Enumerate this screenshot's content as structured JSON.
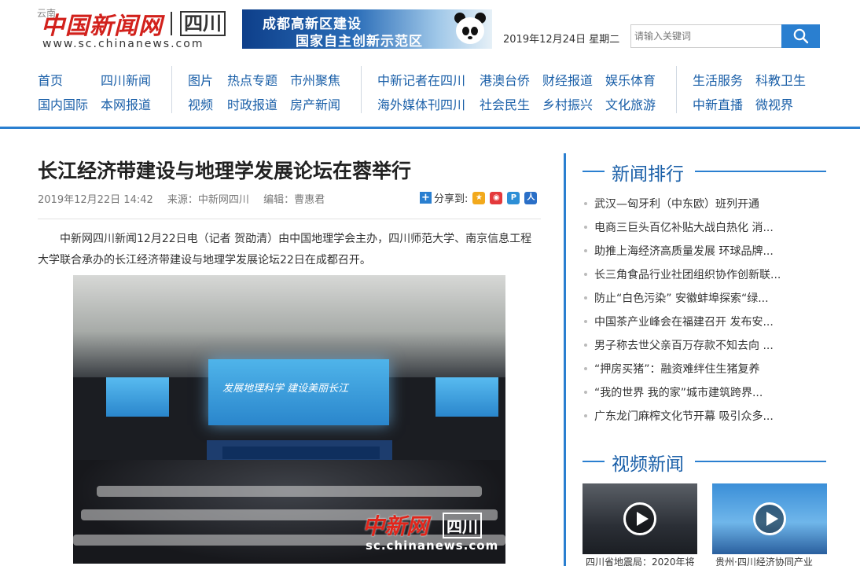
{
  "header": {
    "corner_text": "云南",
    "logo_cn": "中国新闻网",
    "logo_region": "四川",
    "logo_url": "www.sc.chinanews.com",
    "banner_line1": "成都高新区建设",
    "banner_line2": "国家自主创新示范区",
    "date": "2019年12月24日  星期二",
    "search_placeholder": "请输入关键词"
  },
  "nav": {
    "groups": [
      [
        [
          "首页",
          "四川新闻"
        ],
        [
          "国内国际",
          "本网报道"
        ]
      ],
      [
        [
          "图片",
          "热点专题",
          "市州聚焦"
        ],
        [
          "视频",
          "时政报道",
          "房产新闻"
        ]
      ],
      [
        [
          "中新记者在四川",
          "港澳台侨",
          "财经报道",
          "娱乐体育"
        ],
        [
          "海外媒体刊四川",
          "社会民生",
          "乡村振兴",
          "文化旅游"
        ]
      ],
      [
        [
          "生活服务",
          "科教卫生"
        ],
        [
          "中新直播",
          "微视界"
        ]
      ]
    ]
  },
  "article": {
    "title": "长江经济带建设与地理学发展论坛在蓉举行",
    "date": "2019年12月22日  14:42",
    "source": "来源：中新网四川",
    "editor": "编辑：曹惠君",
    "share_label": "分享到:",
    "body": "中新网四川新闻12月22日电（记者 贺劭清）由中国地理学会主办，四川师范大学、南京信息工程大学联合承办的长江经济带建设与地理学发展论坛22日在成都召开。",
    "photo_screen_text": "发展地理科学  建设美丽长江",
    "photo_watermark_cn": "中新网",
    "photo_watermark_region": "四川",
    "photo_watermark_url": "sc.chinanews.com"
  },
  "sidebar": {
    "rank_title": "新闻排行",
    "rank_items": [
      "武汉—匈牙利（中东欧）班列开通",
      "电商三巨头百亿补贴大战白热化 消...",
      "助推上海经济高质量发展 环球品牌...",
      "长三角食品行业社团组织协作创新联...",
      "防止“白色污染” 安徽蚌埠探索“绿...",
      "中国茶产业峰会在福建召开 发布安...",
      "男子称去世父亲百万存款不知去向 ...",
      "“押房买猪”：融资难绊住生猪复养",
      "“我的世界 我的家”城市建筑跨界...",
      "广东龙门麻榨文化节开幕 吸引众多..."
    ],
    "video_title": "视频新闻",
    "videos": [
      {
        "caption": "四川省地震局：2020年将"
      },
      {
        "caption": "贵州·四川经济协同产业"
      }
    ]
  },
  "colors": {
    "brand_red": "#d2211c",
    "nav_blue": "#1a5fa8",
    "accent_blue": "#2a7fd0"
  }
}
